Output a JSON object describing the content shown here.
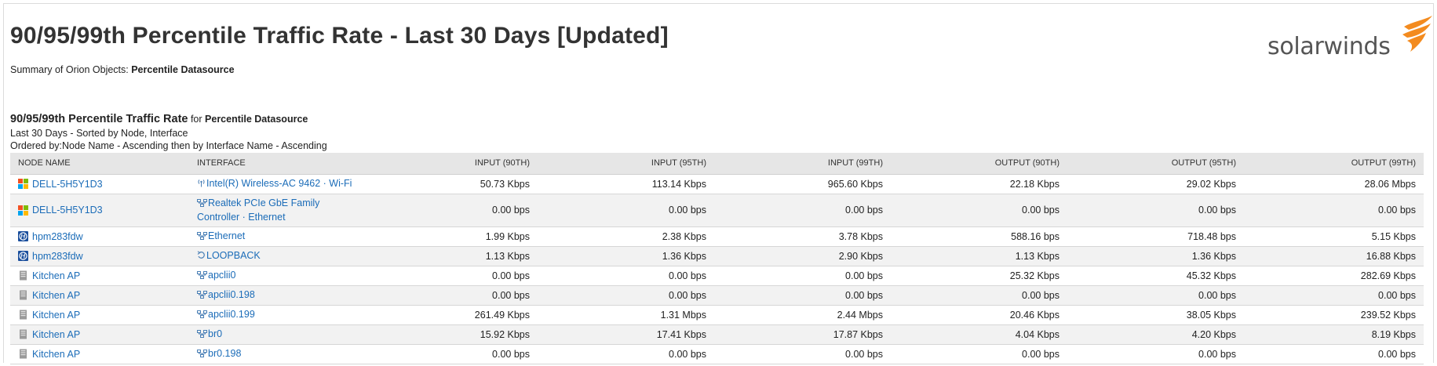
{
  "report": {
    "title": "90/95/99th Percentile Traffic Rate - Last 30 Days [Updated]",
    "summary_prefix": "Summary of Orion Objects: ",
    "summary_value": "Percentile Datasource"
  },
  "logo": {
    "text": "solarwinds",
    "accent_color": "#f38b1f"
  },
  "section": {
    "title": "90/95/99th Percentile Traffic Rate",
    "for_text": " for ",
    "datasource": "Percentile Datasource",
    "line1": "Last 30 Days - Sorted by Node, Interface",
    "line2": "Ordered by:Node Name - Ascending then by Interface Name - Ascending"
  },
  "table": {
    "columns": [
      "NODE NAME",
      "INTERFACE",
      "INPUT (90TH)",
      "INPUT (95TH)",
      "INPUT (99TH)",
      "OUTPUT (90TH)",
      "OUTPUT (95TH)",
      "OUTPUT (99TH)"
    ],
    "rows": [
      {
        "node": "DELL-5H5Y1D3",
        "node_icon": "windows-icon",
        "iface_icon": "wireless-icon",
        "interface": "Intel(R) Wireless-AC 9462 · Wi-Fi",
        "in90": "50.73 Kbps",
        "in95": "113.14 Kbps",
        "in99": "965.60 Kbps",
        "out90": "22.18 Kbps",
        "out95": "29.02 Kbps",
        "out99": "28.06 Mbps"
      },
      {
        "node": "DELL-5H5Y1D3",
        "node_icon": "windows-icon",
        "iface_icon": "ethernet-icon",
        "interface": "Realtek PCIe GbE Family Controller · Ethernet",
        "in90": "0.00 bps",
        "in95": "0.00 bps",
        "in99": "0.00 bps",
        "out90": "0.00 bps",
        "out95": "0.00 bps",
        "out99": "0.00 bps"
      },
      {
        "node": "hpm283fdw",
        "node_icon": "hp-icon",
        "iface_icon": "ethernet-icon",
        "interface": "Ethernet",
        "in90": "1.99 Kbps",
        "in95": "2.38 Kbps",
        "in99": "3.78 Kbps",
        "out90": "588.16 bps",
        "out95": "718.48 bps",
        "out99": "5.15 Kbps"
      },
      {
        "node": "hpm283fdw",
        "node_icon": "hp-icon",
        "iface_icon": "loopback-icon",
        "interface": "LOOPBACK",
        "in90": "1.13 Kbps",
        "in95": "1.36 Kbps",
        "in99": "2.90 Kbps",
        "out90": "1.13 Kbps",
        "out95": "1.36 Kbps",
        "out99": "16.88 Kbps"
      },
      {
        "node": "Kitchen AP",
        "node_icon": "device-icon",
        "iface_icon": "ethernet-icon",
        "interface": "apclii0",
        "in90": "0.00 bps",
        "in95": "0.00 bps",
        "in99": "0.00 bps",
        "out90": "25.32 Kbps",
        "out95": "45.32 Kbps",
        "out99": "282.69 Kbps"
      },
      {
        "node": "Kitchen AP",
        "node_icon": "device-icon",
        "iface_icon": "ethernet-icon",
        "interface": "apclii0.198",
        "in90": "0.00 bps",
        "in95": "0.00 bps",
        "in99": "0.00 bps",
        "out90": "0.00 bps",
        "out95": "0.00 bps",
        "out99": "0.00 bps"
      },
      {
        "node": "Kitchen AP",
        "node_icon": "device-icon",
        "iface_icon": "ethernet-icon",
        "interface": "apclii0.199",
        "in90": "261.49 Kbps",
        "in95": "1.31 Mbps",
        "in99": "2.44 Mbps",
        "out90": "20.46 Kbps",
        "out95": "38.05 Kbps",
        "out99": "239.52 Kbps"
      },
      {
        "node": "Kitchen AP",
        "node_icon": "device-icon",
        "iface_icon": "ethernet-icon",
        "interface": "br0",
        "in90": "15.92 Kbps",
        "in95": "17.41 Kbps",
        "in99": "17.87 Kbps",
        "out90": "4.04 Kbps",
        "out95": "4.20 Kbps",
        "out99": "8.19 Kbps"
      },
      {
        "node": "Kitchen AP",
        "node_icon": "device-icon",
        "iface_icon": "ethernet-icon",
        "interface": "br0.198",
        "in90": "0.00 bps",
        "in95": "0.00 bps",
        "in99": "0.00 bps",
        "out90": "0.00 bps",
        "out95": "0.00 bps",
        "out99": "0.00 bps"
      }
    ]
  }
}
